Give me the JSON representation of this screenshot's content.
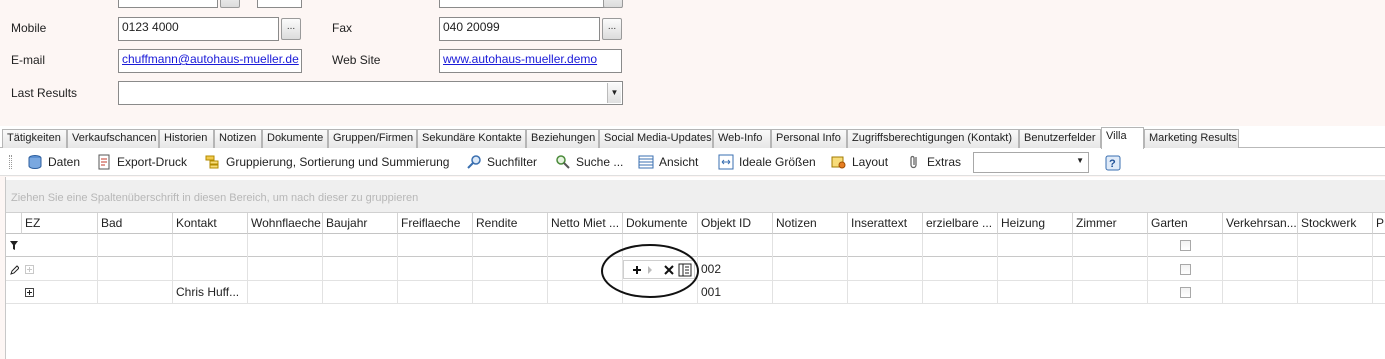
{
  "form": {
    "mobile_label": "Mobile",
    "mobile_value": "0123 4000",
    "fax_label": "Fax",
    "fax_value": "040 20099",
    "email_label": "E-mail",
    "email_value": "chuffmann@autohaus-mueller.de",
    "website_label": "Web Site",
    "website_value": "www.autohaus-mueller.demo",
    "last_results_label": "Last Results",
    "last_results_value": "",
    "ellipsis_label": "..."
  },
  "tabs": [
    "Tätigkeiten",
    "Verkaufschancen",
    "Historien",
    "Notizen",
    "Dokumente",
    "Gruppen/Firmen",
    "Sekundäre Kontakte",
    "Beziehungen",
    "Social Media-Updates",
    "Web-Info",
    "Personal Info",
    "Zugriffsberechtigungen (Kontakt)",
    "Benutzerfelder",
    "Villa",
    "Marketing Results"
  ],
  "active_tab": "Villa",
  "toolbar": {
    "daten": "Daten",
    "export": "Export-Druck",
    "gruppierung": "Gruppierung, Sortierung und Summierung",
    "suchfilter": "Suchfilter",
    "suche": "Suche ...",
    "ansicht": "Ansicht",
    "ideale": "Ideale Größen",
    "layout": "Layout",
    "extras": "Extras",
    "combo_value": ""
  },
  "grid": {
    "group_hint": "Ziehen Sie eine Spaltenüberschrift in diesen Bereich, um nach dieser zu gruppieren",
    "columns": [
      "EZ",
      "Bad",
      "Kontakt",
      "Wohnflaeche",
      "Baujahr",
      "Freiflaeche",
      "Rendite",
      "Netto Miet ...",
      "Dokumente",
      "Objekt ID",
      "Notizen",
      "Inserattext",
      "erzielbare ...",
      "Heizung",
      "Zimmer",
      "Garten",
      "Verkehrsan...",
      "Stockwerk",
      "PL"
    ],
    "rows": [
      {
        "kontakt": "",
        "objekt_id": "002"
      },
      {
        "kontakt": "Chris Huff...",
        "objekt_id": "001"
      }
    ]
  },
  "icons": {
    "combo_arrow": "chevron-down-icon",
    "row_editor": "pencil-icon",
    "filter_row": "filter-icon",
    "add": "plus-icon",
    "delete": "x-icon",
    "detail": "form-icon",
    "help": "help-icon"
  },
  "colors": {
    "form_bg": "#fdf6f4",
    "link": "#1a1ad8",
    "group_panel": "#efefef",
    "group_hint_text": "#b7b7b7"
  }
}
